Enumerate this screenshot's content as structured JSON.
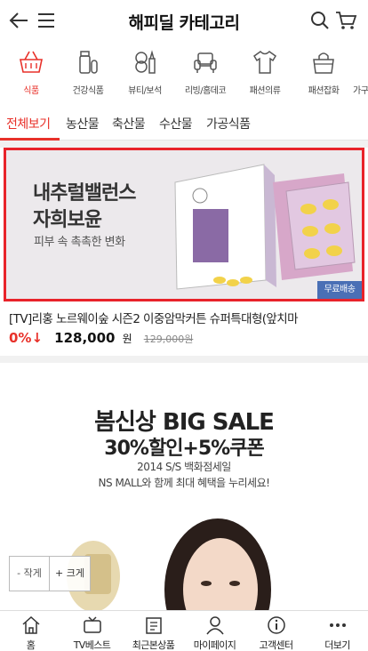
{
  "header": {
    "title": "해피딜 카테고리"
  },
  "categories": [
    {
      "label": "식품",
      "icon": "food-basket-icon",
      "active": true
    },
    {
      "label": "건강식품",
      "icon": "pill-bottle-icon",
      "active": false
    },
    {
      "label": "뷰티/보석",
      "icon": "cosmetics-icon",
      "active": false
    },
    {
      "label": "리빙/홈데코",
      "icon": "sofa-icon",
      "active": false
    },
    {
      "label": "패션의류",
      "icon": "tshirt-icon",
      "active": false
    },
    {
      "label": "패션잡화",
      "icon": "handbag-icon",
      "active": false
    },
    {
      "label": "가구",
      "icon": "furniture-icon",
      "active": false
    }
  ],
  "tabs": [
    {
      "label": "전체보기",
      "active": true
    },
    {
      "label": "농산물",
      "active": false
    },
    {
      "label": "축산물",
      "active": false
    },
    {
      "label": "수산물",
      "active": false
    },
    {
      "label": "가공식품",
      "active": false
    }
  ],
  "product": {
    "banner_line1": "내추럴밸런스",
    "banner_line2": "자희보윤",
    "banner_line3": "피부 속 촉촉한 변화",
    "shipping_badge": "무료배송",
    "name": "[TV]리홍 노르웨이숲 시즌2 이중암막커튼 슈퍼특대형(앞치마",
    "discount": "0%↓",
    "price": "128,000",
    "currency": "원",
    "original_price": "129,000원"
  },
  "promo": {
    "headline1": "봄신상 BIG SALE",
    "headline2": "30%할인+5%쿠폰",
    "sub1": "2014 S/S 백화점세일",
    "sub2": "NS MALL와 함께 최대 혜택을 누리세요!"
  },
  "zoom": {
    "zoom_out": "- 작게",
    "zoom_in": "+ 크게"
  },
  "bottom_nav": [
    {
      "label": "홈",
      "icon": "home-icon"
    },
    {
      "label": "TV베스트",
      "icon": "tv-icon"
    },
    {
      "label": "최근본상품",
      "icon": "recent-items-icon"
    },
    {
      "label": "마이페이지",
      "icon": "person-icon"
    },
    {
      "label": "고객센터",
      "icon": "info-icon"
    },
    {
      "label": "더보기",
      "icon": "more-dots-icon"
    }
  ],
  "colors": {
    "accent": "#e8312a",
    "badge": "#4a6fb5"
  }
}
